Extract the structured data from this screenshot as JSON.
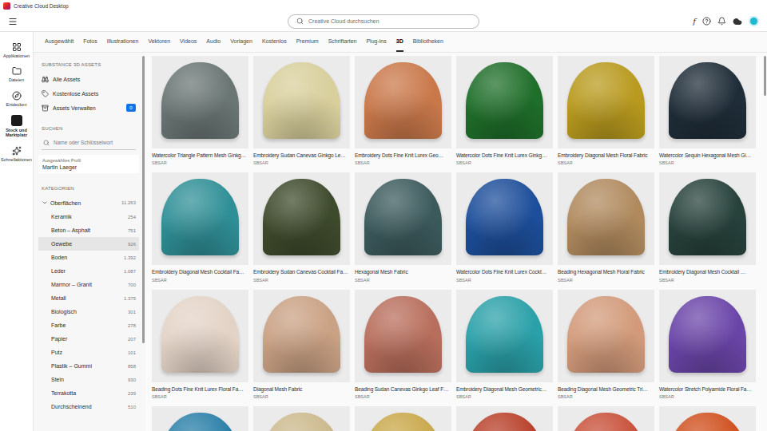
{
  "window": {
    "title": "Creative Cloud Desktop"
  },
  "header": {
    "search_placeholder": "Creative Cloud durchsuchen",
    "fonts_glyph": "f"
  },
  "rail": [
    {
      "label": "Applikationen",
      "selected": false
    },
    {
      "label": "Dateien",
      "selected": false
    },
    {
      "label": "Entdecken",
      "selected": false
    },
    {
      "label": "Stock und Marktplatz",
      "selected": true
    },
    {
      "label": "Schnellaktionen",
      "selected": false
    }
  ],
  "tabs": [
    {
      "label": "Ausgewählt",
      "selected": false
    },
    {
      "label": "Fotos",
      "selected": false
    },
    {
      "label": "Illustrationen",
      "selected": false
    },
    {
      "label": "Vektoren",
      "selected": false
    },
    {
      "label": "Videos",
      "selected": false
    },
    {
      "label": "Audio",
      "selected": false
    },
    {
      "label": "Vorlagen",
      "selected": false
    },
    {
      "label": "Kostenlos",
      "selected": false
    },
    {
      "label": "Premium",
      "selected": false
    },
    {
      "label": "Schriftarten",
      "selected": false
    },
    {
      "label": "Plug-ins",
      "selected": false
    },
    {
      "label": "3D",
      "selected": true
    },
    {
      "label": "Bibliotheken",
      "selected": false
    }
  ],
  "sidebar": {
    "section_title": "SUBSTANCE 3D ASSETS",
    "items": [
      {
        "label": "Alle Assets"
      },
      {
        "label": "Kostenlose Assets"
      },
      {
        "label": "Assets Verwalten",
        "badge": "0"
      }
    ],
    "search_title": "SUCHEN",
    "search_placeholder": "Name oder Schlüsselwort",
    "profile_label": "Ausgewähltes Profil",
    "profile_name": "Martin Laeger",
    "categories_title": "KATEGORIEN",
    "category": {
      "label": "Oberflächen",
      "count": "11.263",
      "expanded": true
    },
    "subcategories": [
      {
        "label": "Keramik",
        "count": "254",
        "selected": false
      },
      {
        "label": "Beton – Asphalt",
        "count": "751",
        "selected": false
      },
      {
        "label": "Gewebe",
        "count": "926",
        "selected": true
      },
      {
        "label": "Boden",
        "count": "1.392",
        "selected": false
      },
      {
        "label": "Leder",
        "count": "1.087",
        "selected": false
      },
      {
        "label": "Marmor – Granit",
        "count": "700",
        "selected": false
      },
      {
        "label": "Metall",
        "count": "1.375",
        "selected": false
      },
      {
        "label": "Biologisch",
        "count": "301",
        "selected": false
      },
      {
        "label": "Farbe",
        "count": "278",
        "selected": false
      },
      {
        "label": "Papier",
        "count": "207",
        "selected": false
      },
      {
        "label": "Putz",
        "count": "101",
        "selected": false
      },
      {
        "label": "Plastik – Gummi",
        "count": "858",
        "selected": false
      },
      {
        "label": "Stein",
        "count": "930",
        "selected": false
      },
      {
        "label": "Terrakotta",
        "count": "239",
        "selected": false
      },
      {
        "label": "Durchscheinend",
        "count": "510",
        "selected": false
      }
    ]
  },
  "grid": {
    "cards": [
      {
        "title": "Watercolor Triangle Pattern Mesh Ginkg…",
        "format": "SBSAR",
        "color": "#6a7674"
      },
      {
        "title": "Embroidery Sudan Canevas Ginkgo Le…",
        "format": "SBSAR",
        "color": "#d8cf9c"
      },
      {
        "title": "Embroidery Dots Fine Knit Lurex Geo…",
        "format": "SBSAR",
        "color": "#c9784a"
      },
      {
        "title": "Watercolor Dots Fine Knit Lurex Ginkg…",
        "format": "SBSAR",
        "color": "#1f6e2a"
      },
      {
        "title": "Embroidery Diagonal Mesh Floral Fabric",
        "format": "SBSAR",
        "color": "#b89a1e"
      },
      {
        "title": "Watercolor Sequin Hexagonal Mesh Gi…",
        "format": "SBSAR",
        "color": "#1f2d38"
      },
      {
        "title": "Embroidery Diagonal Mesh Cocktail Fa…",
        "format": "SBSAR",
        "color": "#2f8f96"
      },
      {
        "title": "Embroidery Sudan Canevas Cocktail Fa…",
        "format": "SBSAR",
        "color": "#3e4a2c"
      },
      {
        "title": "Hexagonal Mesh Fabric",
        "format": "SBSAR",
        "color": "#3c5a5c"
      },
      {
        "title": "Watercolor Dots Fine Knit Lurex Cockt…",
        "format": "SBSAR",
        "color": "#1d4e9a"
      },
      {
        "title": "Beading Hexagonal Mesh Floral Fabric",
        "format": "SBSAR",
        "color": "#b08a5e"
      },
      {
        "title": "Embroidery Diagonal Mesh Cocktail …",
        "format": "SBSAR",
        "color": "#27413b"
      },
      {
        "title": "Beading Dots Fine Knit Lurex Floral Fa…",
        "format": "SBSAR",
        "color": "#e3d3c6"
      },
      {
        "title": "Diagonal Mesh Fabric",
        "format": "SBSAR",
        "color": "#c9a184"
      },
      {
        "title": "Beading Sudan Canevas Ginkgo Leaf F…",
        "format": "SBSAR",
        "color": "#b86e5c"
      },
      {
        "title": "Embroidery Diagonal Mesh Geometric…",
        "format": "SBSAR",
        "color": "#2aa0a8"
      },
      {
        "title": "Beading Diagonal Mesh Geometric Tri…",
        "format": "SBSAR",
        "color": "#d29a7a"
      },
      {
        "title": "Watercolor Stretch Polyamide Floral Fa…",
        "format": "SBSAR",
        "color": "#6a45a8"
      }
    ],
    "partial_cards": [
      {
        "color": "#2a7fa8"
      },
      {
        "color": "#cbb98c"
      },
      {
        "color": "#c9a84a"
      },
      {
        "color": "#b8402a"
      },
      {
        "color": "#c8503a"
      },
      {
        "color": "#d0501e"
      }
    ]
  }
}
